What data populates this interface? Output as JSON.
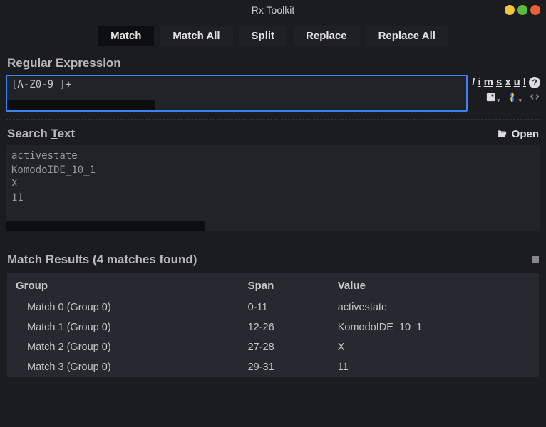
{
  "window": {
    "title": "Rx Toolkit"
  },
  "tabs": [
    "Match",
    "Match All",
    "Split",
    "Replace",
    "Replace All"
  ],
  "regex_label_pre": "Regular ",
  "regex_label_u": "E",
  "regex_label_post": "xpression",
  "regex_value": "[A-Z0-9_]+",
  "flags": {
    "slash": "/",
    "i": "i",
    "m": "m",
    "s": "s",
    "x": "x",
    "u": "u",
    "l": "l"
  },
  "search_label_pre": "Search ",
  "search_label_u": "T",
  "search_label_post": "ext",
  "open_label": "Open",
  "search_lines": [
    "activestate",
    "KomodoIDE_10_1",
    "X",
    "11"
  ],
  "results_label_pre": "Match ",
  "results_label_u": "R",
  "results_label_post": "esults (4 matches found)",
  "columns": {
    "group": "Group",
    "span": "Span",
    "value": "Value"
  },
  "matches": [
    {
      "group": "Match 0 (Group 0)",
      "span": "0-11",
      "value": "activestate"
    },
    {
      "group": "Match 1 (Group 0)",
      "span": "12-26",
      "value": "KomodoIDE_10_1"
    },
    {
      "group": "Match 2 (Group 0)",
      "span": "27-28",
      "value": "X"
    },
    {
      "group": "Match 3 (Group 0)",
      "span": "29-31",
      "value": "11"
    }
  ],
  "colors": {
    "minimize": "#f2c53d",
    "maximize": "#5cbb3a",
    "close": "#e95f3a"
  }
}
